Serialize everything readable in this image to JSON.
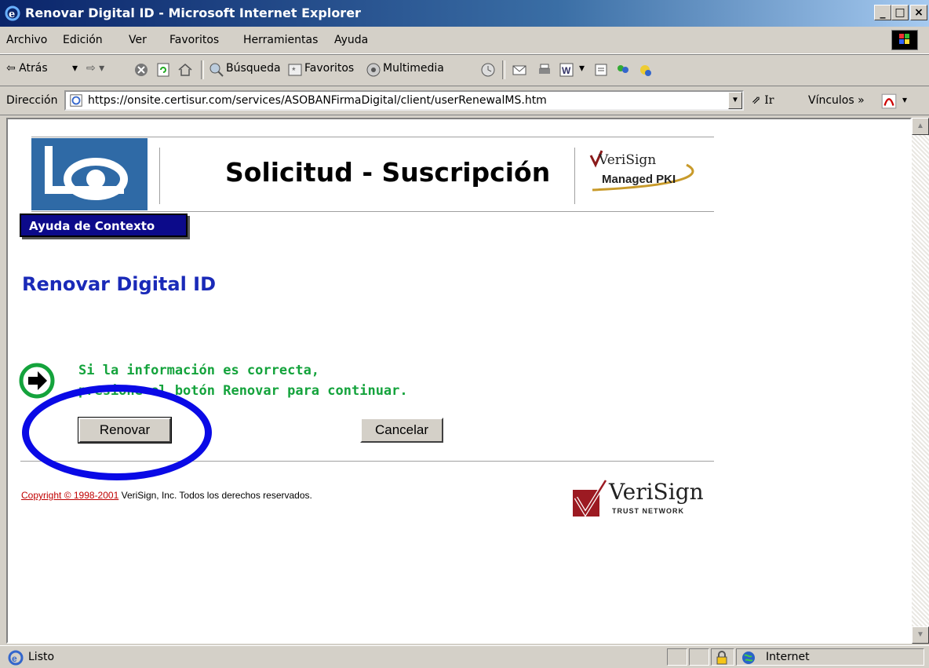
{
  "window": {
    "title": "Renovar Digital ID - Microsoft Internet Explorer",
    "minimize": "_",
    "maximize": "□",
    "close": "×"
  },
  "menu": [
    "Archivo",
    "Edición",
    "Ver",
    "Favoritos",
    "Herramientas",
    "Ayuda"
  ],
  "toolbar": {
    "back": "⇦ Atrás",
    "search": "Búsqueda",
    "favorites": "Favoritos",
    "media": "Multimedia"
  },
  "address": {
    "label": "Dirección",
    "url": "https://onsite.certisur.com/services/ASOBANFirmaDigital/client/userRenewalMS.htm",
    "go": "Ir",
    "links": "Vínculos »"
  },
  "page": {
    "header_title": "Solicitud - Suscripción",
    "verisign_brand": "VeriSign",
    "managed_pki": "Managed PKI",
    "help_button": "Ayuda de Contexto",
    "title": "Renovar Digital ID",
    "info_line1": "Si la información es correcta,",
    "info_line2": "presione el botón Renovar para continuar.",
    "renew_button": "Renovar",
    "cancel_button": "Cancelar",
    "copyright_link": "Copyright © 1998-2001",
    "copyright_text": " VeriSign, Inc. Todos los derechos reservados.",
    "trust_brand": "VeriSign",
    "trust_network": "TRUST NETWORK"
  },
  "status": {
    "text": "Listo",
    "zone": "Internet"
  },
  "colors": {
    "title_blue": "#1a2ab8",
    "info_green": "#14a33c",
    "highlight_circle": "#0a0ae6",
    "help_button_bg": "#0c0a8a"
  }
}
